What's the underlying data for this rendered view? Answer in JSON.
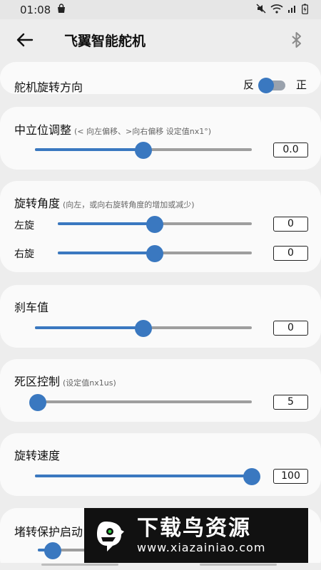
{
  "status_bar": {
    "time": "01:08",
    "battery": "⚡"
  },
  "app_bar": {
    "title": "飞翼智能舵机"
  },
  "direction": {
    "label": "舵机旋转方向",
    "left_option": "反",
    "right_option": "正",
    "on": false
  },
  "neutral": {
    "label": "中立位调整",
    "hint": "(< 向左偏移、>向右偏移 设定值nx1°)",
    "value": "0.0",
    "level": 0.5
  },
  "angle": {
    "label": "旋转角度",
    "hint": "(向左，或向右旋转角度的增加或减少)",
    "left_label": "左旋",
    "left_value": "0",
    "left_level": 0.5,
    "right_label": "右旋",
    "right_value": "0",
    "right_level": 0.5
  },
  "brake": {
    "label": "刹车值",
    "value": "0",
    "level": 0.5
  },
  "deadzone": {
    "label": "死区控制",
    "hint": "(设定值nx1us)",
    "value": "5",
    "level": 0.0
  },
  "speed": {
    "label": "旋转速度",
    "value": "100",
    "level": 1.0
  },
  "stall": {
    "label": "堵转保护启动",
    "level": 0.07
  },
  "watermark": {
    "main": "下载鸟资源",
    "url": "www.xiazainiao.com"
  },
  "colors": {
    "accent": "#3a78c0",
    "track": "#9e9e9e",
    "card": "#fafafa",
    "background": "#ededed"
  }
}
